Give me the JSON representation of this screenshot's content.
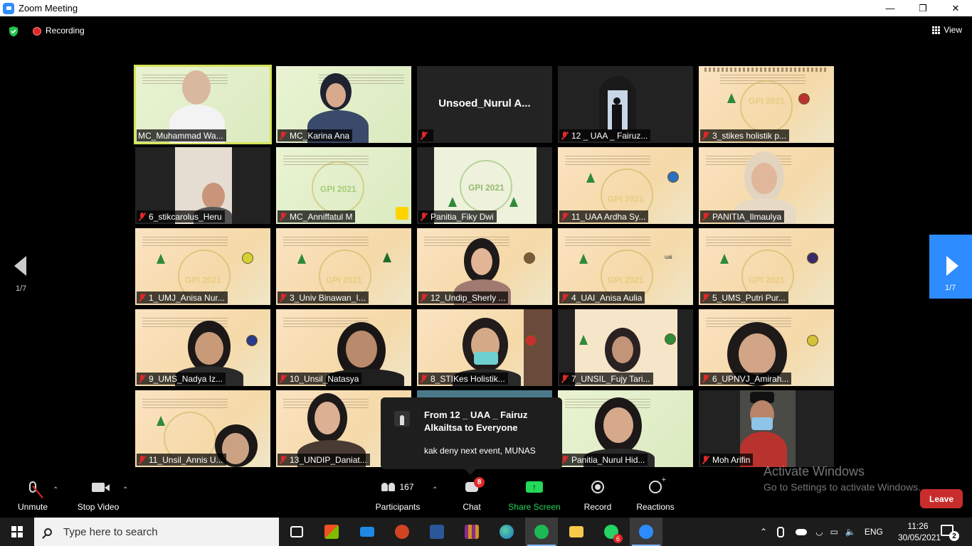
{
  "window": {
    "title": "Zoom Meeting"
  },
  "topbar": {
    "recording_label": "Recording",
    "view_label": "View"
  },
  "pager": {
    "left_page": "1/7",
    "right_page": "1/7"
  },
  "tiles": [
    {
      "name": "MC_Muhammad Wa...",
      "muted": false,
      "active": true
    },
    {
      "name": "MC_Karina Ana",
      "muted": true
    },
    {
      "name": "",
      "muted": true,
      "display_name": "Unsoed_Nurul  A..."
    },
    {
      "name": "12 _ UAA _ Fairuz...",
      "muted": true
    },
    {
      "name": "3_stikes holistik p...",
      "muted": true
    },
    {
      "name": "6_stikcarolus_Heru",
      "muted": true
    },
    {
      "name": "MC_Anniffatul M",
      "muted": true
    },
    {
      "name": "Panitia_Fiky Dwi",
      "muted": true
    },
    {
      "name": "11_UAA Ardha Sy...",
      "muted": true
    },
    {
      "name": "PANITIA_Ilmaulya",
      "muted": true
    },
    {
      "name": "1_UMJ_Anisa Nur...",
      "muted": true
    },
    {
      "name": "3_Univ Binawan_I...",
      "muted": true
    },
    {
      "name": "12_Undip_Sherly ...",
      "muted": true
    },
    {
      "name": "4_UAI_Anisa Aulia",
      "muted": true
    },
    {
      "name": "5_UMS_Putri Pur...",
      "muted": true
    },
    {
      "name": "9_UMS_Nadya Iz...",
      "muted": true
    },
    {
      "name": "10_Unsil_Natasya",
      "muted": true
    },
    {
      "name": "8_STIKes Holistik...",
      "muted": true
    },
    {
      "name": "7_UNSIL_Fujy Tari...",
      "muted": true
    },
    {
      "name": "6_UPNVJ_Amirah...",
      "muted": true
    },
    {
      "name": "11_Unsil_Annis U...",
      "muted": true
    },
    {
      "name": "13_UNDIP_Daniat...",
      "muted": true
    },
    {
      "name": "",
      "muted": false
    },
    {
      "name": "Panitia_Nurul Hid...",
      "muted": true
    },
    {
      "name": "Moh Arifin",
      "muted": true
    }
  ],
  "chat_popup": {
    "from": "From 12 _ UAA _ Fairuz Alkailtsa to Everyone",
    "message": "kak deny next event, MUNAS"
  },
  "watermark": {
    "line1": "Activate Windows",
    "line2": "Go to Settings to activate Windows."
  },
  "toolbar": {
    "unmute": "Unmute",
    "stop_video": "Stop Video",
    "participants": "Participants",
    "participants_count": "167",
    "chat": "Chat",
    "chat_badge": "8",
    "share_screen": "Share Screen",
    "record": "Record",
    "reactions": "Reactions",
    "leave": "Leave"
  },
  "taskbar": {
    "search_placeholder": "Type here to search",
    "language": "ENG",
    "time": "11:26",
    "date": "30/05/2021",
    "whatsapp_badge": "6",
    "notification_count": "2"
  },
  "colors": {
    "accent_blue": "#2d8cff",
    "share_green": "#23d959",
    "leave_red": "#c92c2c",
    "active_speaker": "#d6e35a"
  }
}
